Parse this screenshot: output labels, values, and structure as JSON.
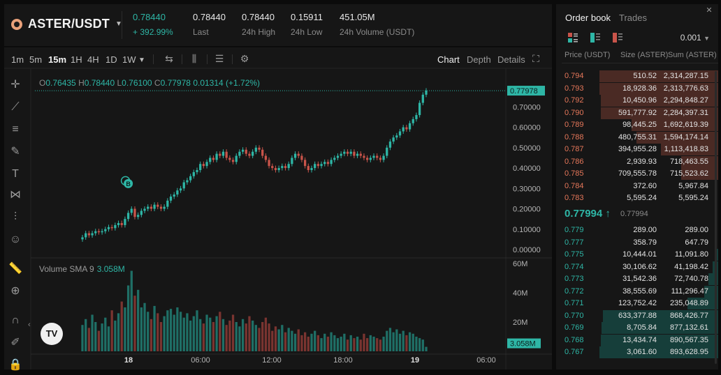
{
  "header": {
    "pair": "ASTER/USDT",
    "price": "0.78440",
    "change": "+ 392.99%",
    "stats": [
      {
        "value": "0.78440",
        "label": "Last"
      },
      {
        "value": "0.78440",
        "label": "24h High"
      },
      {
        "value": "0.15911",
        "label": "24h Low"
      },
      {
        "value": "451.05M",
        "label": "24h Volume (USDT)"
      }
    ]
  },
  "toolbar": {
    "timeframes": [
      "1m",
      "5m",
      "15m",
      "1H",
      "4H",
      "1D",
      "1W"
    ],
    "active_timeframe": "15m",
    "tabs": [
      "Chart",
      "Depth",
      "Details"
    ],
    "active_tab": "Chart"
  },
  "ohlc": {
    "o_label": "O",
    "o": "0.76435",
    "h_label": "H",
    "h": "0.78440",
    "l_label": "L",
    "l": "0.76100",
    "c_label": "C",
    "c": "0.77978",
    "change": "0.01314 (+1.72%)"
  },
  "volume": {
    "label": "Volume SMA 9",
    "value": "3.058M",
    "axis": [
      "60M",
      "40M",
      "20M"
    ],
    "current_tag": "3.058M"
  },
  "chart_data": {
    "type": "candlestick",
    "price_axis": [
      "0.70000",
      "0.60000",
      "0.50000",
      "0.40000",
      "0.30000",
      "0.20000",
      "0.10000",
      "0.00000"
    ],
    "current_price_tag": "0.77978",
    "x_labels": [
      "18",
      "06:00",
      "12:00",
      "18:00",
      "19",
      "06:00"
    ],
    "ylim": [
      0.0,
      0.78
    ],
    "marker": "B",
    "candles_close": [
      0.06,
      0.08,
      0.07,
      0.08,
      0.09,
      0.085,
      0.09,
      0.1,
      0.11,
      0.105,
      0.12,
      0.13,
      0.12,
      0.15,
      0.18,
      0.2,
      0.16,
      0.17,
      0.19,
      0.2,
      0.21,
      0.2,
      0.22,
      0.21,
      0.2,
      0.21,
      0.24,
      0.26,
      0.27,
      0.29,
      0.3,
      0.33,
      0.34,
      0.36,
      0.38,
      0.39,
      0.42,
      0.41,
      0.43,
      0.45,
      0.44,
      0.47,
      0.46,
      0.48,
      0.45,
      0.44,
      0.43,
      0.46,
      0.48,
      0.49,
      0.47,
      0.46,
      0.48,
      0.5,
      0.49,
      0.46,
      0.44,
      0.41,
      0.4,
      0.39,
      0.4,
      0.41,
      0.4,
      0.42,
      0.45,
      0.47,
      0.46,
      0.44,
      0.41,
      0.39,
      0.4,
      0.42,
      0.41,
      0.42,
      0.43,
      0.42,
      0.44,
      0.45,
      0.46,
      0.47,
      0.48,
      0.47,
      0.48,
      0.46,
      0.47,
      0.46,
      0.45,
      0.44,
      0.45,
      0.46,
      0.45,
      0.44,
      0.46,
      0.5,
      0.53,
      0.55,
      0.56,
      0.58,
      0.6,
      0.59,
      0.62,
      0.64,
      0.66,
      0.72,
      0.76,
      0.78
    ],
    "volume_values": [
      18,
      22,
      16,
      25,
      20,
      14,
      19,
      23,
      17,
      28,
      21,
      26,
      34,
      30,
      45,
      55,
      38,
      42,
      30,
      33,
      27,
      22,
      31,
      26,
      20,
      24,
      28,
      29,
      25,
      30,
      27,
      23,
      26,
      21,
      24,
      28,
      22,
      19,
      25,
      23,
      20,
      24,
      27,
      22,
      18,
      21,
      25,
      20,
      17,
      22,
      19,
      24,
      21,
      18,
      16,
      20,
      23,
      19,
      14,
      17,
      15,
      18,
      13,
      16,
      14,
      12,
      15,
      11,
      13,
      10,
      12,
      14,
      11,
      9,
      12,
      10,
      13,
      11,
      9,
      10,
      12,
      8,
      11,
      9,
      10,
      8,
      12,
      9,
      11,
      10,
      9,
      8,
      10,
      14,
      16,
      13,
      15,
      12,
      14,
      11,
      13,
      12,
      10,
      9,
      8,
      3.06
    ]
  },
  "orderbook": {
    "tabs": [
      "Order book",
      "Trades"
    ],
    "active_tab": "Order book",
    "precision": "0.001",
    "headers": [
      "Price (USDT)",
      "Size (ASTER)",
      "Sum (ASTER)"
    ],
    "asks": [
      {
        "price": "0.794",
        "size": "510.52",
        "sum": "2,314,287.15",
        "depth": 1.0
      },
      {
        "price": "0.793",
        "size": "18,928.36",
        "sum": "2,313,776.63",
        "depth": 1.0
      },
      {
        "price": "0.792",
        "size": "10,450.96",
        "sum": "2,294,848.27",
        "depth": 0.99
      },
      {
        "price": "0.790",
        "size": "591,777.92",
        "sum": "2,284,397.31",
        "depth": 0.99
      },
      {
        "price": "0.789",
        "size": "98,445.25",
        "sum": "1,692,619.39",
        "depth": 0.73
      },
      {
        "price": "0.788",
        "size": "480,755.31",
        "sum": "1,594,174.14",
        "depth": 0.69
      },
      {
        "price": "0.787",
        "size": "394,955.28",
        "sum": "1,113,418.83",
        "depth": 0.48
      },
      {
        "price": "0.786",
        "size": "2,939.93",
        "sum": "718,463.55",
        "depth": 0.31
      },
      {
        "price": "0.785",
        "size": "709,555.78",
        "sum": "715,523.62",
        "depth": 0.31
      },
      {
        "price": "0.784",
        "size": "372.60",
        "sum": "5,967.84",
        "depth": 0.0
      },
      {
        "price": "0.783",
        "size": "5,595.24",
        "sum": "5,595.24",
        "depth": 0.0
      }
    ],
    "mid_price": "0.77994 ↑",
    "mark_price": "0.77994",
    "bids": [
      {
        "price": "0.779",
        "size": "289.00",
        "sum": "289.00",
        "depth": 0.0
      },
      {
        "price": "0.777",
        "size": "358.79",
        "sum": "647.79",
        "depth": 0.0
      },
      {
        "price": "0.775",
        "size": "10,444.01",
        "sum": "11,091.80",
        "depth": 0.01
      },
      {
        "price": "0.774",
        "size": "30,106.62",
        "sum": "41,198.42",
        "depth": 0.05
      },
      {
        "price": "0.773",
        "size": "31,542.36",
        "sum": "72,740.78",
        "depth": 0.08
      },
      {
        "price": "0.772",
        "size": "38,555.69",
        "sum": "111,296.47",
        "depth": 0.12
      },
      {
        "price": "0.771",
        "size": "123,752.42",
        "sum": "235,048.89",
        "depth": 0.26
      },
      {
        "price": "0.770",
        "size": "633,377.88",
        "sum": "868,426.77",
        "depth": 0.97
      },
      {
        "price": "0.769",
        "size": "8,705.84",
        "sum": "877,132.61",
        "depth": 0.98
      },
      {
        "price": "0.768",
        "size": "13,434.74",
        "sum": "890,567.35",
        "depth": 0.99
      },
      {
        "price": "0.767",
        "size": "3,061.60",
        "sum": "893,628.95",
        "depth": 1.0
      }
    ]
  },
  "colors": {
    "up": "#2eb6a6",
    "down": "#c9544a",
    "ask_depth": "#4a2a24",
    "bid_depth": "#163e3a"
  }
}
